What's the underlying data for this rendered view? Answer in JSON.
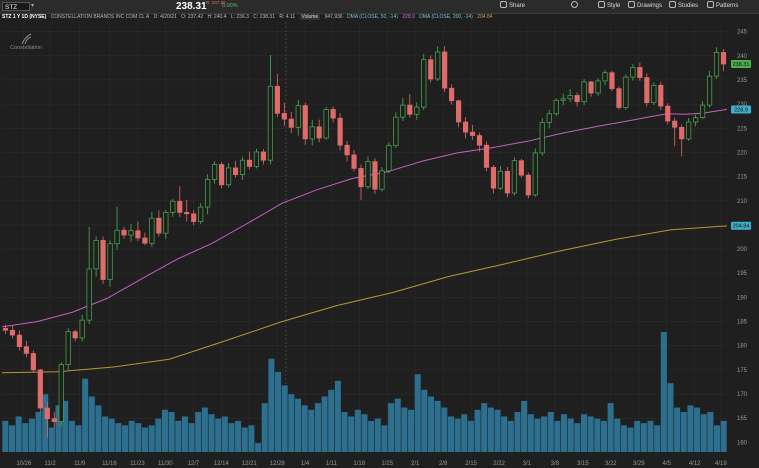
{
  "toolbar": {
    "symbol": "STZ",
    "last_price": "238.31",
    "change": "0.0",
    "change_pct": "0.00%",
    "change_line2": "R: 237.80",
    "buttons": {
      "share": "Share",
      "style": "Style",
      "drawings": "Drawings",
      "studies": "Studies",
      "patterns": "Patterns"
    }
  },
  "legend": {
    "symbol_period": "STZ 1 Y 1D (NYSE)",
    "name": "CONSTELLATION BRANDS INC COM CL A",
    "date": "D: 4/20/21",
    "open": "O: 237.42",
    "high": "H: 240.4",
    "low": "L: 236.3",
    "close": "C: 238.31",
    "range": "R: 4.11",
    "volume_label": "Volume",
    "volume_value": "947,936",
    "sma50_label": "DMA (CLOSE, 50, -14)",
    "sma50_value": "228.9",
    "sma200_label": "DMA (CLOSE, 200, -14)",
    "sma200_value": "204.84"
  },
  "logo_text": "Constellation",
  "colors": {
    "up": "#4caf50",
    "down": "#e06b6b",
    "sma50": "#c162c1",
    "sma200": "#b8963a",
    "volume": "#2d6f8e",
    "last_price_tag": "#4caf50",
    "sma50_tag": "#3fb0c8",
    "sma200_tag": "#3fb0c8"
  },
  "chart_data": {
    "type": "candlestick",
    "ylim": [
      158,
      247
    ],
    "y_ticks": [
      160,
      165,
      170,
      175,
      180,
      185,
      190,
      195,
      200,
      205,
      210,
      215,
      220,
      225,
      230,
      235,
      240,
      245
    ],
    "x_tick_labels": [
      {
        "i": 12,
        "label": "10/26"
      },
      {
        "i": 27,
        "label": "11/2"
      },
      {
        "i": 44,
        "label": "11/9"
      },
      {
        "i": 61,
        "label": "11/16"
      },
      {
        "i": 77,
        "label": "11/23"
      },
      {
        "i": 93,
        "label": "11/30"
      },
      {
        "i": 109,
        "label": "12/7"
      },
      {
        "i": 125,
        "label": "12/14"
      },
      {
        "i": 141,
        "label": "12/21"
      },
      {
        "i": 157,
        "label": "12/28"
      },
      {
        "i": 173,
        "label": "1/4"
      },
      {
        "i": 188,
        "label": "1/11"
      },
      {
        "i": 204,
        "label": "1/18"
      },
      {
        "i": 220,
        "label": "1/25"
      },
      {
        "i": 236,
        "label": "2/1"
      },
      {
        "i": 252,
        "label": "2/8"
      },
      {
        "i": 268,
        "label": "2/15"
      },
      {
        "i": 284,
        "label": "2/22"
      },
      {
        "i": 300,
        "label": "3/1"
      },
      {
        "i": 316,
        "label": "3/8"
      },
      {
        "i": 332,
        "label": "3/15"
      },
      {
        "i": 348,
        "label": "3/22"
      },
      {
        "i": 364,
        "label": "3/29"
      },
      {
        "i": 380,
        "label": "4/5"
      },
      {
        "i": 396,
        "label": "4/12"
      },
      {
        "i": 411,
        "label": "4/19"
      }
    ],
    "x_slots": 415,
    "candles": [
      [
        183.6,
        184.4,
        182.4,
        183.2
      ],
      [
        183.2,
        184.1,
        181.5,
        182.2
      ],
      [
        182.2,
        183.2,
        179.0,
        179.8
      ],
      [
        179.8,
        181.0,
        177.6,
        178.4
      ],
      [
        178.4,
        179.0,
        174.4,
        175.0
      ],
      [
        175.0,
        175.2,
        166.2,
        167.1
      ],
      [
        167.1,
        168.3,
        161.0,
        164.9
      ],
      [
        164.9,
        166.3,
        163.0,
        164.3
      ],
      [
        164.3,
        176.6,
        163.2,
        176.1
      ],
      [
        176.1,
        183.6,
        175.0,
        182.9
      ],
      [
        182.9,
        183.3,
        180.9,
        181.6
      ],
      [
        181.6,
        186.4,
        180.9,
        185.3
      ],
      [
        185.3,
        204.6,
        184.5,
        195.9
      ],
      [
        195.9,
        202.7,
        194.3,
        201.8
      ],
      [
        201.8,
        202.6,
        192.8,
        193.7
      ],
      [
        193.7,
        201.8,
        192.2,
        201.1
      ],
      [
        201.1,
        208.8,
        199.8,
        203.9
      ],
      [
        203.9,
        204.6,
        202.1,
        202.9
      ],
      [
        202.9,
        205.2,
        201.5,
        203.8
      ],
      [
        203.8,
        205.7,
        201.6,
        202.3
      ],
      [
        202.3,
        203.4,
        200.8,
        201.2
      ],
      [
        201.2,
        207.7,
        200.4,
        206.4
      ],
      [
        206.4,
        208.0,
        202.6,
        203.3
      ],
      [
        203.3,
        208.1,
        202.1,
        207.6
      ],
      [
        207.6,
        210.4,
        206.7,
        209.9
      ],
      [
        209.9,
        213.0,
        206.6,
        207.6
      ],
      [
        207.6,
        210.2,
        205.7,
        207.3
      ],
      [
        207.3,
        208.0,
        204.9,
        205.7
      ],
      [
        205.7,
        209.5,
        205.2,
        208.7
      ],
      [
        208.7,
        215.5,
        207.2,
        214.4
      ],
      [
        214.4,
        218.2,
        213.5,
        217.5
      ],
      [
        217.5,
        218.0,
        212.6,
        213.3
      ],
      [
        213.3,
        217.8,
        212.8,
        216.8
      ],
      [
        216.8,
        218.3,
        214.8,
        215.4
      ],
      [
        215.4,
        219.1,
        214.3,
        218.4
      ],
      [
        218.4,
        220.2,
        216.5,
        217.1
      ],
      [
        217.1,
        220.8,
        216.7,
        220.1
      ],
      [
        220.1,
        220.7,
        217.5,
        218.4
      ],
      [
        218.4,
        240.2,
        217.5,
        233.7
      ],
      [
        233.7,
        236.3,
        227.3,
        228.1
      ],
      [
        228.1,
        230.3,
        225.5,
        226.9
      ],
      [
        226.9,
        228.4,
        224.0,
        225.2
      ],
      [
        225.2,
        230.9,
        223.5,
        229.7
      ],
      [
        229.7,
        230.3,
        221.6,
        222.8
      ],
      [
        222.8,
        226.7,
        221.4,
        225.3
      ],
      [
        225.3,
        226.8,
        222.1,
        223.0
      ],
      [
        223.0,
        229.4,
        222.6,
        228.9
      ],
      [
        228.9,
        229.5,
        226.2,
        227.1
      ],
      [
        227.1,
        228.1,
        220.4,
        221.5
      ],
      [
        221.5,
        222.4,
        218.1,
        219.5
      ],
      [
        219.5,
        220.5,
        216.0,
        216.7
      ],
      [
        216.7,
        217.5,
        210.1,
        212.9
      ],
      [
        212.9,
        219.2,
        212.4,
        218.1
      ],
      [
        218.1,
        218.8,
        211.4,
        212.4
      ],
      [
        212.4,
        217.0,
        211.9,
        216.2
      ],
      [
        216.2,
        222.1,
        215.7,
        221.4
      ],
      [
        221.4,
        228.3,
        220.9,
        227.3
      ],
      [
        227.3,
        231.3,
        226.5,
        229.8
      ],
      [
        229.8,
        232.1,
        227.2,
        227.9
      ],
      [
        227.9,
        230.4,
        226.8,
        229.4
      ],
      [
        229.4,
        240.4,
        228.8,
        239.2
      ],
      [
        239.2,
        240.1,
        234.5,
        235.2
      ],
      [
        235.2,
        242.0,
        234.8,
        240.8
      ],
      [
        240.8,
        242.0,
        232.5,
        233.3
      ],
      [
        233.3,
        234.1,
        229.9,
        230.7
      ],
      [
        230.7,
        230.9,
        225.2,
        226.3
      ],
      [
        226.3,
        227.3,
        222.9,
        224.2
      ],
      [
        224.2,
        225.7,
        222.6,
        223.5
      ],
      [
        223.5,
        224.1,
        220.2,
        221.5
      ],
      [
        221.5,
        222.3,
        216.1,
        216.9
      ],
      [
        216.9,
        217.4,
        211.5,
        212.6
      ],
      [
        212.6,
        217.2,
        212.2,
        216.1
      ],
      [
        216.1,
        217.0,
        210.7,
        211.6
      ],
      [
        211.6,
        219.0,
        211.1,
        218.3
      ],
      [
        218.3,
        218.7,
        214.8,
        215.3
      ],
      [
        215.3,
        215.8,
        210.5,
        211.2
      ],
      [
        211.2,
        220.8,
        210.8,
        219.9
      ],
      [
        219.9,
        227.1,
        219.3,
        226.2
      ],
      [
        226.2,
        228.8,
        225.0,
        228.0
      ],
      [
        228.0,
        231.2,
        227.6,
        230.8
      ],
      [
        230.8,
        232.2,
        229.7,
        231.1
      ],
      [
        231.1,
        233.1,
        230.4,
        231.8
      ],
      [
        231.8,
        232.4,
        229.5,
        230.5
      ],
      [
        230.5,
        235.2,
        229.8,
        234.6
      ],
      [
        234.6,
        234.8,
        231.5,
        232.3
      ],
      [
        232.3,
        235.4,
        231.7,
        234.8
      ],
      [
        234.8,
        237.1,
        233.9,
        236.5
      ],
      [
        236.5,
        236.9,
        232.7,
        233.2
      ],
      [
        233.2,
        233.7,
        228.9,
        229.3
      ],
      [
        229.3,
        236.2,
        228.8,
        235.6
      ],
      [
        235.6,
        238.3,
        234.9,
        237.6
      ],
      [
        237.6,
        238.6,
        234.8,
        235.5
      ],
      [
        235.5,
        236.4,
        229.5,
        230.3
      ],
      [
        230.3,
        234.5,
        229.8,
        233.9
      ],
      [
        233.9,
        234.6,
        228.8,
        229.6
      ],
      [
        229.6,
        230.2,
        225.8,
        226.5
      ],
      [
        226.5,
        227.2,
        221.3,
        225.2
      ],
      [
        225.2,
        225.8,
        219.2,
        222.8
      ],
      [
        222.8,
        227.1,
        222.4,
        226.3
      ],
      [
        226.3,
        227.8,
        225.4,
        227.2
      ],
      [
        227.2,
        230.6,
        226.9,
        229.8
      ],
      [
        229.8,
        236.9,
        229.3,
        235.8
      ],
      [
        235.8,
        241.8,
        235.2,
        240.7
      ],
      [
        240.7,
        241.4,
        236.8,
        238.3
      ]
    ],
    "sma50": [
      [
        0,
        183.9
      ],
      [
        20,
        185.0
      ],
      [
        40,
        186.9
      ],
      [
        60,
        189.8
      ],
      [
        80,
        193.9
      ],
      [
        100,
        197.9
      ],
      [
        120,
        201.2
      ],
      [
        140,
        205.3
      ],
      [
        160,
        209.5
      ],
      [
        180,
        212.3
      ],
      [
        200,
        214.6
      ],
      [
        220,
        216.0
      ],
      [
        240,
        218.2
      ],
      [
        260,
        219.9
      ],
      [
        280,
        221.0
      ],
      [
        300,
        222.3
      ],
      [
        320,
        224.0
      ],
      [
        340,
        225.4
      ],
      [
        360,
        226.7
      ],
      [
        370,
        227.4
      ],
      [
        380,
        228.0
      ],
      [
        390,
        227.9
      ],
      [
        400,
        228.1
      ],
      [
        414,
        228.9
      ]
    ],
    "sma200": [
      [
        0,
        174.4
      ],
      [
        40,
        174.6
      ],
      [
        80,
        175.6
      ],
      [
        120,
        177.2
      ],
      [
        160,
        181.0
      ],
      [
        200,
        184.9
      ],
      [
        240,
        188.3
      ],
      [
        280,
        191.0
      ],
      [
        320,
        194.3
      ],
      [
        360,
        196.9
      ],
      [
        400,
        199.6
      ],
      [
        440,
        202.0
      ],
      [
        480,
        204.0
      ],
      [
        520,
        204.8
      ]
    ],
    "volume": [
      0.7,
      0.6,
      0.8,
      0.65,
      0.75,
      0.9,
      1.3,
      0.55,
      1.05,
      1.15,
      0.7,
      0.6,
      1.65,
      1.25,
      1.05,
      0.8,
      0.75,
      0.65,
      0.6,
      0.7,
      0.65,
      0.55,
      0.6,
      0.75,
      0.95,
      0.9,
      0.7,
      0.8,
      0.65,
      0.9,
      1.0,
      0.85,
      0.75,
      0.8,
      0.65,
      0.7,
      0.55,
      0.6,
      0.2,
      1.1,
      2.1,
      1.8,
      1.5,
      1.3,
      1.2,
      1.05,
      0.95,
      1.1,
      1.25,
      1.4,
      1.6,
      0.9,
      0.8,
      0.95,
      0.85,
      0.7,
      0.75,
      0.6,
      1.1,
      1.2,
      1.0,
      0.95,
      1.75,
      1.4,
      1.25,
      1.15,
      1.0,
      0.8,
      0.75,
      0.85,
      0.7,
      0.95,
      1.1,
      1.0,
      0.95,
      0.8,
      0.7,
      0.9,
      1.15,
      0.85,
      0.75,
      0.8,
      0.9,
      0.7,
      0.85,
      0.75,
      0.65,
      0.85,
      0.8,
      0.75,
      0.7,
      1.1,
      0.75,
      0.6,
      0.55,
      0.7,
      0.65,
      0.7,
      0.6,
      2.7,
      1.55,
      1.0,
      0.9,
      1.05,
      1.0,
      0.85,
      0.9,
      0.6,
      0.7
    ],
    "last_price": 238.31,
    "sma50_last": 228.9,
    "sma200_last": 204.84
  }
}
